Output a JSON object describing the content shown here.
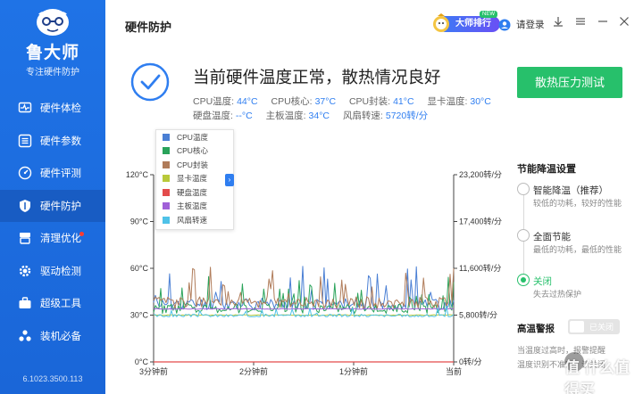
{
  "app": {
    "brand": "鲁大师",
    "subtitle": "专注硬件防护",
    "version": "6.1023.3500.113"
  },
  "sidebar": {
    "items": [
      {
        "label": "硬件体检",
        "icon": "pulse-monitor-icon",
        "active": false
      },
      {
        "label": "硬件参数",
        "icon": "list-icon",
        "active": false
      },
      {
        "label": "硬件评测",
        "icon": "speedometer-icon",
        "active": false
      },
      {
        "label": "硬件防护",
        "icon": "shield-icon",
        "active": true
      },
      {
        "label": "清理优化",
        "icon": "broom-icon",
        "active": false,
        "badge": "red-dot"
      },
      {
        "label": "驱动检测",
        "icon": "gear-icon",
        "active": false
      },
      {
        "label": "超级工具",
        "icon": "toolbox-icon",
        "active": false
      },
      {
        "label": "装机必备",
        "icon": "apps-icon",
        "active": false
      }
    ]
  },
  "header": {
    "title": "硬件防护",
    "rank_label": "大师排行",
    "rank_badge": "NEW",
    "login_label": "请登录"
  },
  "status": {
    "headline": "当前硬件温度正常，散热情况良好",
    "readings_row1": [
      {
        "label": "CPU温度:",
        "value": "44°C"
      },
      {
        "label": "CPU核心:",
        "value": "37°C"
      },
      {
        "label": "CPU封装:",
        "value": "41°C"
      },
      {
        "label": "显卡温度:",
        "value": "30°C"
      }
    ],
    "readings_row2": [
      {
        "label": "硬盘温度:",
        "value": "--°C"
      },
      {
        "label": "主板温度:",
        "value": "34°C"
      },
      {
        "label": "风扇转速:",
        "value": "5720转/分"
      }
    ]
  },
  "stress_test_label": "散热压力测试",
  "chart_data": {
    "type": "line",
    "x_labels": [
      "3分钟前",
      "2分钟前",
      "1分钟前",
      "当前"
    ],
    "y_left_ticks": [
      "0°C",
      "30°C",
      "60°C",
      "90°C",
      "120°C"
    ],
    "y_right_ticks": [
      "0转/分",
      "5,800转/分",
      "11,600转/分",
      "17,400转/分",
      "23,200转/分"
    ],
    "ylim_left": [
      0,
      120
    ],
    "ylim_right": [
      0,
      23200
    ],
    "legend": [
      {
        "name": "CPU温度",
        "color": "#4a7fd4"
      },
      {
        "name": "CPU核心",
        "color": "#2aa35a"
      },
      {
        "name": "CPU封装",
        "color": "#b07c5a"
      },
      {
        "name": "显卡温度",
        "color": "#b9c93a"
      },
      {
        "name": "硬盘温度",
        "color": "#e34b4b"
      },
      {
        "name": "主板温度",
        "color": "#a061d8"
      },
      {
        "name": "风扇转速",
        "color": "#4fc2e8"
      }
    ],
    "series": [
      {
        "name": "CPU温度",
        "axis": "left",
        "min": 32,
        "max": 62,
        "base": 37,
        "spike_prob": 0.18,
        "seed": 11
      },
      {
        "name": "CPU核心",
        "axis": "left",
        "min": 30,
        "max": 55,
        "base": 34,
        "spike_prob": 0.15,
        "seed": 23
      },
      {
        "name": "CPU封装",
        "axis": "left",
        "min": 33,
        "max": 63,
        "base": 38,
        "spike_prob": 0.18,
        "seed": 37
      },
      {
        "name": "显卡温度",
        "axis": "left",
        "min": 29,
        "max": 31,
        "base": 30,
        "spike_prob": 0.0,
        "seed": 41
      },
      {
        "name": "主板温度",
        "axis": "left",
        "min": 33,
        "max": 35,
        "base": 34,
        "spike_prob": 0.0,
        "seed": 53
      },
      {
        "name": "风扇转速",
        "axis": "right",
        "min": 5600,
        "max": 7200,
        "base": 5720,
        "spike_prob": 0.05,
        "seed": 67
      }
    ]
  },
  "panel": {
    "title": "节能降温设置",
    "options": [
      {
        "label": "智能降温（推荐）",
        "desc": "较低的功耗，较好的性能",
        "checked": false
      },
      {
        "label": "全面节能",
        "desc": "最低的功耗，最低的性能",
        "checked": false
      },
      {
        "label": "关闭",
        "desc": "失去过热保护",
        "checked": true
      }
    ],
    "alert_title": "高温警报",
    "alert_toggle": "已关闭",
    "alert_desc1": "当温度过高时，报警提醒",
    "alert_desc2": "温度识别不准时，请关闭"
  },
  "watermark": "值 什么值得买"
}
